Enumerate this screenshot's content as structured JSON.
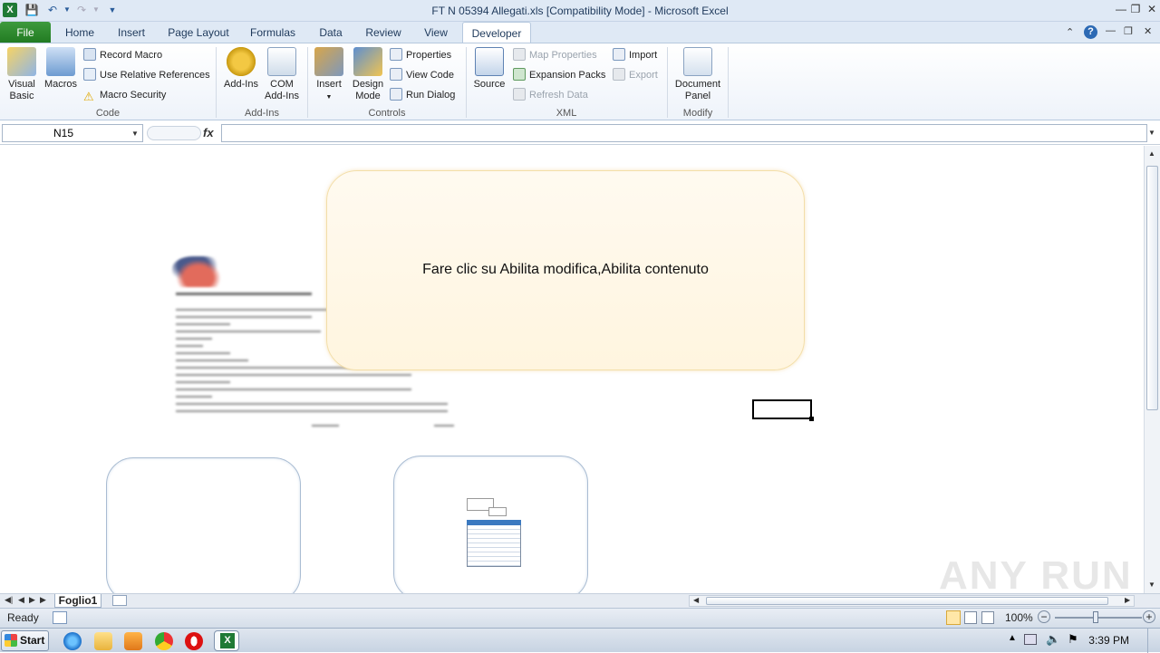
{
  "titlebar": {
    "title": "FT N 05394 Allegati.xls  [Compatibility Mode]  -  Microsoft Excel",
    "app_icon": "excel-icon"
  },
  "tabs": [
    "File",
    "Home",
    "Insert",
    "Page Layout",
    "Formulas",
    "Data",
    "Review",
    "View",
    "Developer"
  ],
  "active_tab": "Developer",
  "ribbon": {
    "code": {
      "label": "Code",
      "visual_basic": "Visual Basic",
      "macros": "Macros",
      "record_macro": "Record Macro",
      "relative_refs": "Use Relative References",
      "macro_security": "Macro Security"
    },
    "addins": {
      "label": "Add-Ins",
      "addins": "Add-Ins",
      "com_1": "COM",
      "com_2": "Add-Ins"
    },
    "controls": {
      "label": "Controls",
      "insert": "Insert",
      "design_1": "Design",
      "design_2": "Mode",
      "properties": "Properties",
      "view_code": "View Code",
      "run_dialog": "Run Dialog"
    },
    "xml": {
      "label": "XML",
      "source": "Source",
      "map_properties": "Map Properties",
      "expansion_packs": "Expansion Packs",
      "refresh_data": "Refresh Data",
      "import": "Import",
      "export": "Export"
    },
    "modify": {
      "label": "Modify",
      "doc_1": "Document",
      "doc_2": "Panel"
    }
  },
  "formula_bar": {
    "name_box": "N15",
    "fx": "fx",
    "formula": ""
  },
  "sheet": {
    "notice": "Fare clic su Abilita modifica,Abilita contenuto"
  },
  "sheet_tabs": {
    "active": "Foglio1"
  },
  "status": {
    "ready": "Ready",
    "zoom": "100%"
  },
  "taskbar": {
    "start": "Start",
    "clock": "3:39 PM"
  },
  "watermark": "ANY RUN",
  "colors": {
    "file_tab": "#2f7d32",
    "notice_bg": "#fff8e8",
    "excel_green": "#1f7a35"
  }
}
